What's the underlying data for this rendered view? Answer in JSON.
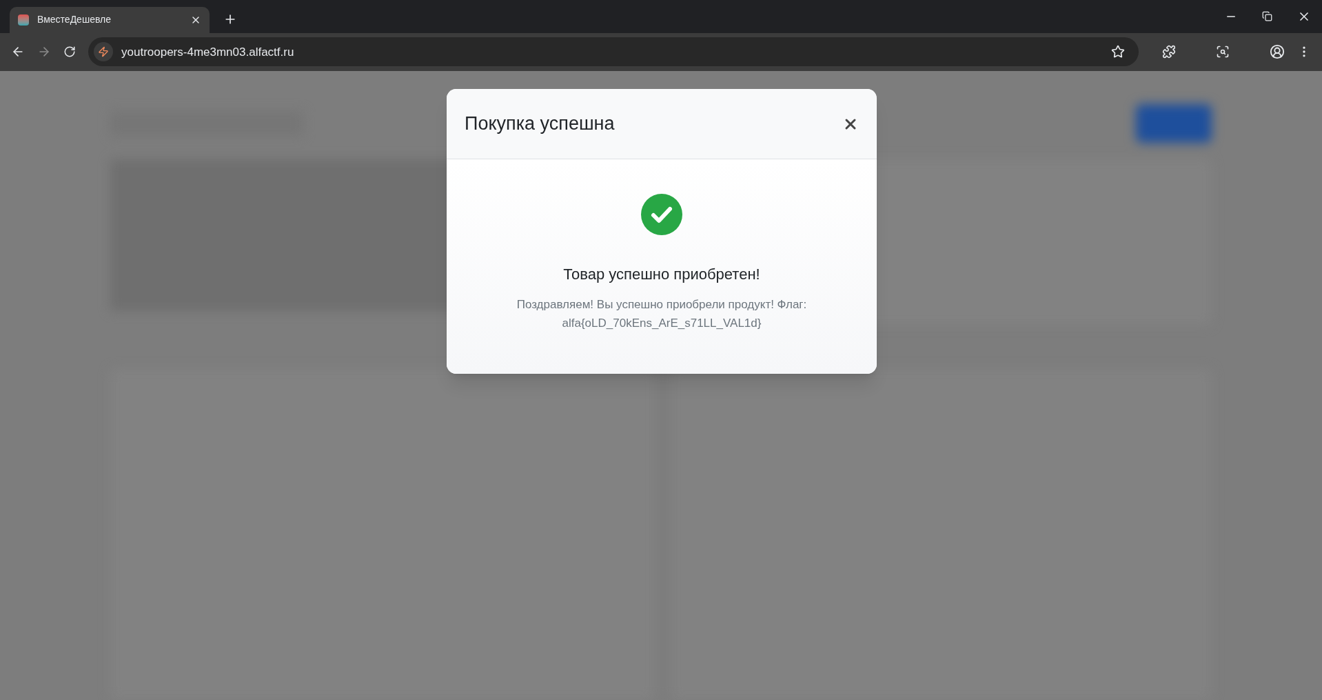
{
  "browser": {
    "tab": {
      "title": "ВместеДешевле",
      "selected": true
    },
    "address": "youtroopers-4me3mn03.alfactf.ru"
  },
  "modal": {
    "title": "Покупка успешна",
    "heading": "Товар успешно приобретен!",
    "message": "Поздравляем! Вы успешно приобрели продукт! Флаг: alfa{oLD_70kEns_ArE_s71LL_VAL1d}"
  }
}
